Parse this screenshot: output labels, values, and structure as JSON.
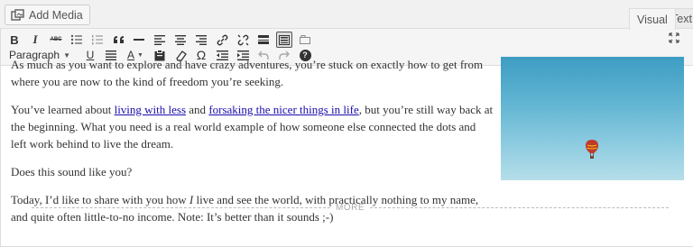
{
  "top_bar": {
    "add_media_label": "Add Media",
    "tabs": [
      {
        "label": "Visual",
        "active": true
      },
      {
        "label": "Text",
        "active": false
      }
    ]
  },
  "toolbar": {
    "format_select_value": "Paragraph",
    "row1_icons": [
      "bold-icon",
      "italic-icon",
      "strikethrough-icon",
      "bullet-list-icon",
      "numbered-list-icon",
      "blockquote-icon",
      "horizontal-line-icon",
      "align-left-icon",
      "align-center-icon",
      "align-right-icon",
      "link-icon",
      "unlink-icon",
      "read-more-icon",
      "toolbar-toggle-icon",
      "distraction-free-icon"
    ],
    "row2_icons": [
      "underline-icon",
      "justify-icon",
      "text-color-icon",
      "paste-text-icon",
      "clear-formatting-icon",
      "special-character-icon",
      "decrease-indent-icon",
      "increase-indent-icon",
      "undo-icon",
      "redo-icon",
      "help-icon"
    ],
    "bold_glyph": "B",
    "italic_glyph": "I",
    "strike_glyph": "ABC",
    "underline_glyph": "U",
    "color_glyph": "A",
    "omega_glyph": "Ω",
    "help_glyph": "?",
    "accent_color": "#0073aa"
  },
  "content": {
    "p1": "As much as you want to explore and have crazy adventures, you’re stuck on exactly how to get from where you are now to the kind of freedom you’re seeking.",
    "p2_before": "You’ve learned about ",
    "p2_link1": "living with less",
    "p2_mid": " and ",
    "p2_link2": "forsaking the nicer things in life",
    "p2_after": ", but you’re still way back at the beginning. What you need is a real world example of how someone else connected the dots and left work behind to live the dream.",
    "p3": "Does this sound like you?",
    "p4_before": "Today, I’d like to share with you how ",
    "p4_em": "I",
    "p4_after": " live and see the world, with practically nothing to my name, and quite often little-to-no income. Note: It’s better than it sounds ;-)",
    "more_label": "MORE",
    "image": {
      "sky_color": "#5eb3d1",
      "balloon_color": "#c0392b"
    }
  }
}
